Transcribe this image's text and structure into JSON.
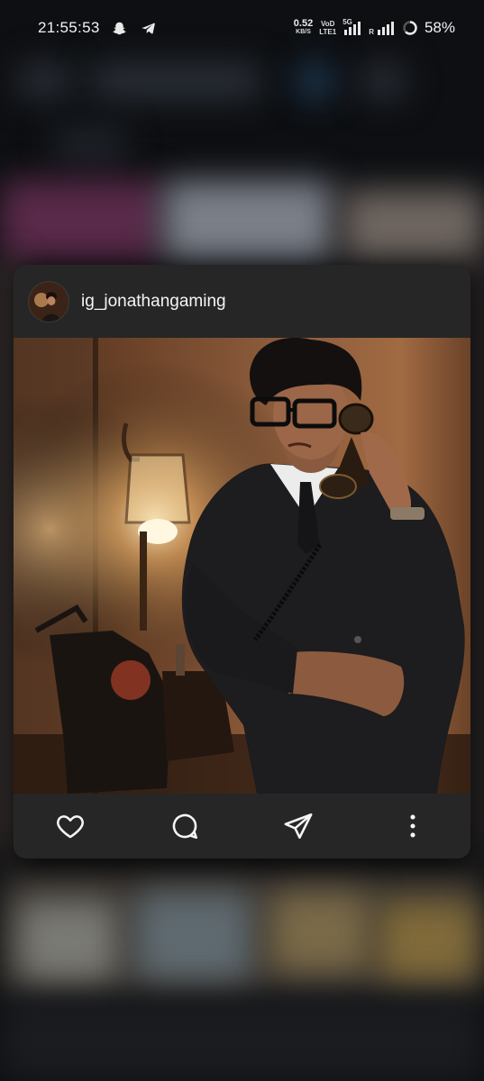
{
  "status_bar": {
    "time": "21:55:53",
    "net_speed_value": "0.52",
    "net_speed_unit": "KB/S",
    "volte_top": "VoD",
    "volte_bottom": "LTE1",
    "network_badge": "5G",
    "roaming": "R",
    "battery": "58%",
    "icons": [
      "snapchat-icon",
      "telegram-icon",
      "signal-icon",
      "battery-icon"
    ]
  },
  "post": {
    "username": "ig_jonathangaming",
    "image_alt": "Man in suit with vintage telephone and lamp",
    "actions": [
      "like-icon",
      "comment-icon",
      "share-icon",
      "more-options-icon"
    ]
  },
  "colors": {
    "card_bg": "#262626",
    "page_bg": "#0d0f12"
  }
}
